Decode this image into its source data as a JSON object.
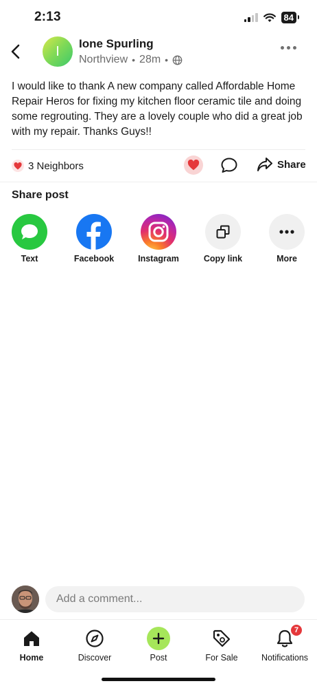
{
  "status_bar": {
    "time": "2:13",
    "battery": "84"
  },
  "author": {
    "initial": "I",
    "name": "Ione Spurling",
    "neighborhood": "Northview",
    "time_ago": "28m",
    "dot": "•"
  },
  "post": {
    "body": "I would like to thank A new company called Affordable Home Repair Heros for fixing my kitchen floor ceramic tile and doing some regrouting. They are a lovely couple who did a great job with my repair. Thanks Guys!!"
  },
  "reactions": {
    "neighbors_label": "3 Neighbors",
    "share_label": "Share"
  },
  "share_section": {
    "title": "Share post",
    "items": [
      {
        "label": "Text",
        "icon": "message-bubble-icon"
      },
      {
        "label": "Facebook",
        "icon": "facebook-icon"
      },
      {
        "label": "Instagram",
        "icon": "instagram-icon"
      },
      {
        "label": "Copy link",
        "icon": "copy-icon"
      },
      {
        "label": "More",
        "icon": "ellipsis-icon"
      }
    ]
  },
  "comment": {
    "placeholder": "Add a comment..."
  },
  "nav": {
    "items": [
      {
        "label": "Home",
        "icon": "home-icon",
        "active": true
      },
      {
        "label": "Discover",
        "icon": "compass-icon"
      },
      {
        "label": "Post",
        "icon": "plus-icon"
      },
      {
        "label": "For Sale",
        "icon": "tag-icon"
      },
      {
        "label": "Notifications",
        "icon": "bell-icon",
        "badge": "7"
      }
    ]
  },
  "colors": {
    "accent_green": "#a6e65a",
    "heart_red": "#e5383b",
    "badge_red": "#e5383b"
  }
}
